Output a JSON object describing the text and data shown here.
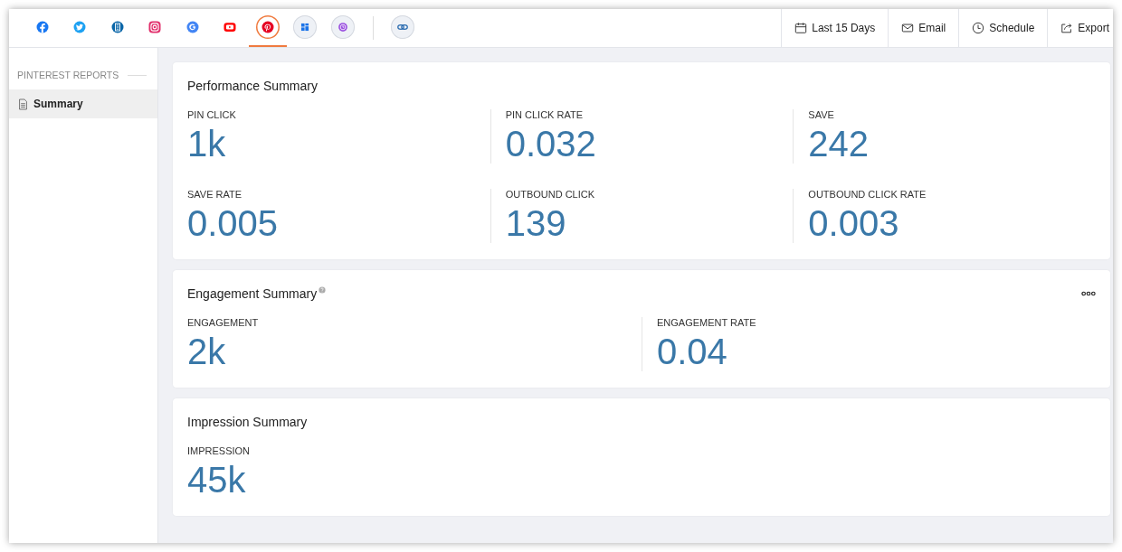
{
  "networks": [
    {
      "kind": "facebook",
      "selected": false
    },
    {
      "kind": "twitter",
      "selected": false
    },
    {
      "kind": "building",
      "selected": false
    },
    {
      "kind": "instagram",
      "selected": false
    },
    {
      "kind": "google",
      "selected": false
    },
    {
      "kind": "youtube",
      "selected": false
    },
    {
      "kind": "pinterest",
      "selected": true
    },
    {
      "kind": "grid",
      "selected": false
    },
    {
      "kind": "clock",
      "selected": false
    },
    {
      "kind": "link",
      "selected": false
    }
  ],
  "toolbar": [
    {
      "kind": "calendar",
      "label": "Last 15 Days"
    },
    {
      "kind": "email",
      "label": "Email"
    },
    {
      "kind": "schedule",
      "label": "Schedule"
    },
    {
      "kind": "export",
      "label": "Export"
    }
  ],
  "sidebar": {
    "heading": "PINTEREST REPORTS",
    "items": [
      {
        "label": "Summary",
        "selected": true
      }
    ]
  },
  "sections": [
    {
      "title": "Performance Summary",
      "help": false,
      "menu": false,
      "metrics": [
        {
          "label": "PIN CLICK",
          "value": "1k"
        },
        {
          "label": "PIN CLICK RATE",
          "value": "0.032"
        },
        {
          "label": "SAVE",
          "value": "242"
        },
        {
          "label": "SAVE RATE",
          "value": "0.005"
        },
        {
          "label": "OUTBOUND CLICK",
          "value": "139"
        },
        {
          "label": "OUTBOUND CLICK RATE",
          "value": "0.003"
        }
      ]
    },
    {
      "title": "Engagement Summary",
      "help": true,
      "menu": true,
      "metrics": [
        {
          "label": "ENGAGEMENT",
          "value": "2k"
        },
        {
          "label": "ENGAGEMENT RATE",
          "value": "0.04"
        }
      ]
    },
    {
      "title": "Impression Summary",
      "help": false,
      "menu": false,
      "metrics": [
        {
          "label": "IMPRESSION",
          "value": "45k"
        }
      ]
    }
  ]
}
